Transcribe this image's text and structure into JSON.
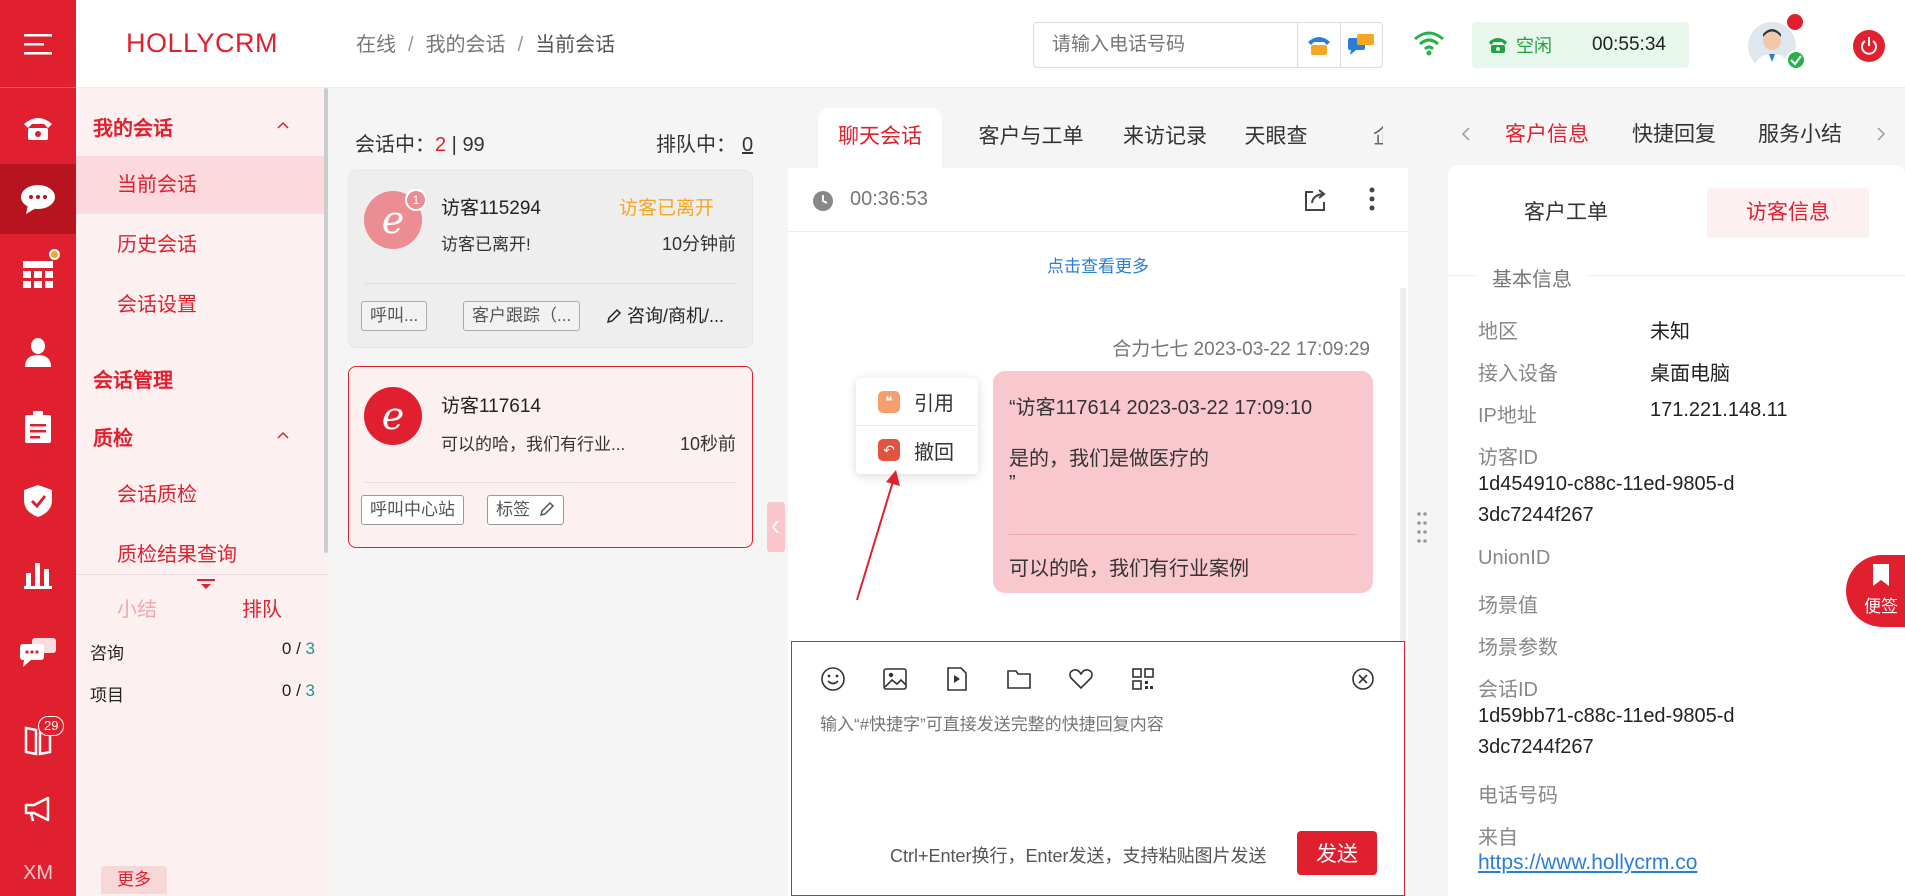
{
  "app": {
    "brand": "HOLLYCRM"
  },
  "rail": {
    "items": [
      {
        "icon": "phone-icon"
      },
      {
        "icon": "chat-icon",
        "active": true
      },
      {
        "icon": "grid-icon",
        "dot": true
      },
      {
        "icon": "user-icon"
      },
      {
        "icon": "clipboard-icon"
      },
      {
        "icon": "shield-icon"
      },
      {
        "icon": "bar-chart-icon"
      },
      {
        "icon": "messages-icon"
      },
      {
        "icon": "book-icon",
        "badge": "29"
      },
      {
        "icon": "megaphone-icon"
      }
    ],
    "footer": "XM"
  },
  "nav": {
    "group1": "我的会话",
    "item_current": "当前会话",
    "item_history": "历史会话",
    "item_settings": "会话设置",
    "group2": "会话管理",
    "group3": "质检",
    "item_qc": "会话质检",
    "item_qc_result": "质检结果查询",
    "bottom": {
      "tab_summary": "小结",
      "tab_queue": "排队",
      "rows": [
        {
          "label": "咨询",
          "done": "0",
          "sep": " / ",
          "total": "3"
        },
        {
          "label": "项目",
          "done": "0",
          "sep": " / ",
          "total": "3"
        }
      ],
      "more": "更多"
    }
  },
  "header": {
    "breadcrumb": [
      "在线",
      "我的会话",
      "当前会话"
    ],
    "phone_placeholder": "请输入电话号码",
    "status_label": "空闲",
    "status_time": "00:55:34"
  },
  "sessions": {
    "in_session_label": "会话中：",
    "in_session_count": "2",
    "in_session_sep": " | ",
    "in_session_max": "99",
    "queue_label": "排队中：",
    "queue_count": "0",
    "cards": [
      {
        "badge": "1",
        "name": "访客115294",
        "state": "访客已离开",
        "message": "访客已离开!",
        "time": "10分钟前",
        "tags": [
          "呼叫...",
          "客户跟踪（..."
        ],
        "extra": "咨询/商机/..."
      },
      {
        "name": "访客117614",
        "message": "可以的哈，我们有行业...",
        "time": "10秒前",
        "tags": [
          "呼叫中心站",
          "标签"
        ]
      }
    ]
  },
  "chat": {
    "tabs": [
      "聊天会话",
      "客户与工单",
      "来访记录",
      "天眼查",
      "企"
    ],
    "timer": "00:36:53",
    "see_more": "点击查看更多",
    "message_meta": "合力七七 2023-03-22 17:09:29",
    "quote_line1": "“访客117614 2023-03-22 17:09:10",
    "quote_line2": "是的，我们是做医疗的",
    "quote_line3": "”",
    "reply": "可以的哈，我们有行业案例",
    "context_menu": [
      "引用",
      "撤回"
    ],
    "input_placeholder": "输入“#快捷字”可直接发送完整的快捷回复内容",
    "hint": "Ctrl+Enter换行，Enter发送，支持粘贴图片发送",
    "send": "发送"
  },
  "right": {
    "tabs": [
      "客户信息",
      "快捷回复",
      "服务小结"
    ],
    "subtabs": [
      "客户工单",
      "访客信息"
    ],
    "section": "基本信息",
    "region_label": "地区",
    "region_value": "未知",
    "device_label": "接入设备",
    "device_value": "桌面电脑",
    "ip_label": "IP地址",
    "ip_value": "171.221.148.11",
    "visitor_id_label": "访客ID",
    "visitor_id_value": "1d454910-c88c-11ed-9805-d3dc7244f267",
    "unionid_label": "UnionID",
    "scene_label": "场景值",
    "scene_params_label": "场景参数",
    "session_id_label": "会话ID",
    "session_id_value": "1d59bb71-c88c-11ed-9805-d3dc7244f267",
    "phone_label": "电话号码",
    "from_label": "来自",
    "from_value": "https://www.hollycrm.co",
    "sticky": "便签"
  },
  "colors": {
    "brand_red": "#e0202e",
    "queue_green": "#1a9a8c",
    "link_blue": "#2a7dd8",
    "warn_orange": "#f5a623"
  }
}
